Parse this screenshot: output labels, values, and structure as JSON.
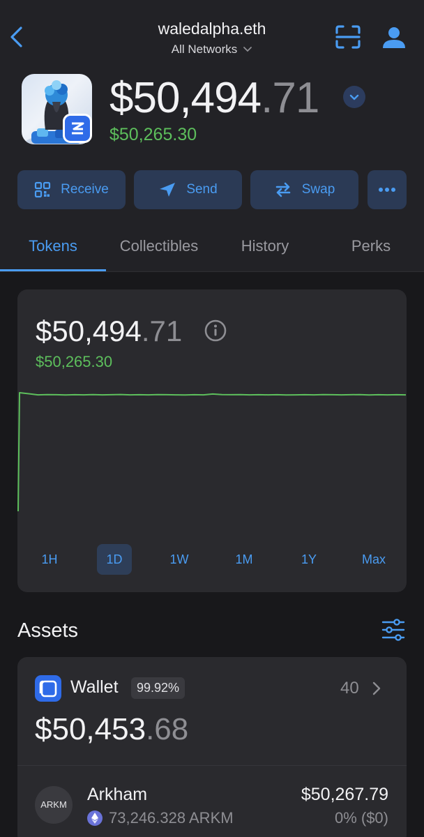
{
  "header": {
    "ens_name": "waledalpha.eth",
    "network": "All Networks"
  },
  "balance": {
    "whole": "$50,494",
    "cents": ".71",
    "secondary": "$50,265.30"
  },
  "actions": {
    "receive": "Receive",
    "send": "Send",
    "swap": "Swap"
  },
  "tabs": [
    {
      "label": "Tokens",
      "active": true
    },
    {
      "label": "Collectibles",
      "active": false
    },
    {
      "label": "History",
      "active": false
    },
    {
      "label": "Perks",
      "active": false
    }
  ],
  "chart_card": {
    "whole": "$50,494",
    "cents": ".71",
    "secondary": "$50,265.30",
    "line_color": "#5dbf5c",
    "ranges": [
      "1H",
      "1D",
      "1W",
      "1M",
      "1Y",
      "Max"
    ],
    "selected_range": "1D"
  },
  "chart_data": {
    "type": "line",
    "series": [
      {
        "values": [
          0,
          100,
          99.1,
          98.2,
          98.4,
          98.3,
          98.1,
          98.3,
          98.2,
          98.4,
          98.2,
          98.3,
          98.5,
          98.2,
          98.3,
          98.2,
          98.4,
          98.3,
          98.2,
          98.1,
          98.3,
          98.2,
          98.9,
          98.4,
          98.3,
          98.4,
          98.2,
          98.3,
          98.2,
          98.3,
          98.1,
          98.2,
          98.3,
          98.2,
          98.4,
          98.3,
          98.2,
          98.3,
          98.4,
          98.1,
          98.3,
          98.2,
          98.3,
          98.2
        ]
      }
    ],
    "ylim": [
      0,
      100
    ],
    "grid": false,
    "legend": "none"
  },
  "assets": {
    "title": "Assets",
    "wallet": {
      "label": "Wallet",
      "percent": "99.92%",
      "count": "40",
      "whole": "$50,453",
      "cents": ".68"
    },
    "tokens": [
      {
        "logo_text": "ARKM",
        "name": "Arkham",
        "amount": "73,246.328 ARKM",
        "value": "$50,267.79",
        "change": "0% ($0)"
      }
    ]
  },
  "colors": {
    "accent": "#4a9cf2",
    "positive": "#5dbf5c",
    "background": "#18181b",
    "surface": "#2a2a2e"
  }
}
